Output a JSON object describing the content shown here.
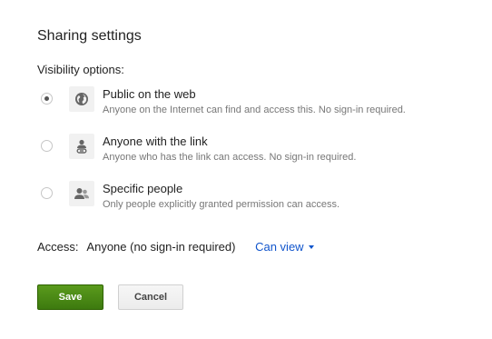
{
  "dialog": {
    "title": "Sharing settings",
    "visibility_label": "Visibility options:",
    "options": [
      {
        "title": "Public on the web",
        "description": "Anyone on the Internet can find and access this. No sign-in required.",
        "icon": "globe-icon",
        "selected": true
      },
      {
        "title": "Anyone with the link",
        "description": "Anyone who has the link can access. No sign-in required.",
        "icon": "person-link-icon",
        "selected": false
      },
      {
        "title": "Specific people",
        "description": "Only people explicitly granted permission can access.",
        "icon": "people-icon",
        "selected": false
      }
    ],
    "access": {
      "label": "Access:",
      "value": "Anyone (no sign-in required)",
      "dropdown_label": "Can view"
    },
    "buttons": {
      "save": "Save",
      "cancel": "Cancel"
    }
  },
  "colors": {
    "link": "#1155cc",
    "save_button": "#4a8a16",
    "description_text": "#777777"
  }
}
